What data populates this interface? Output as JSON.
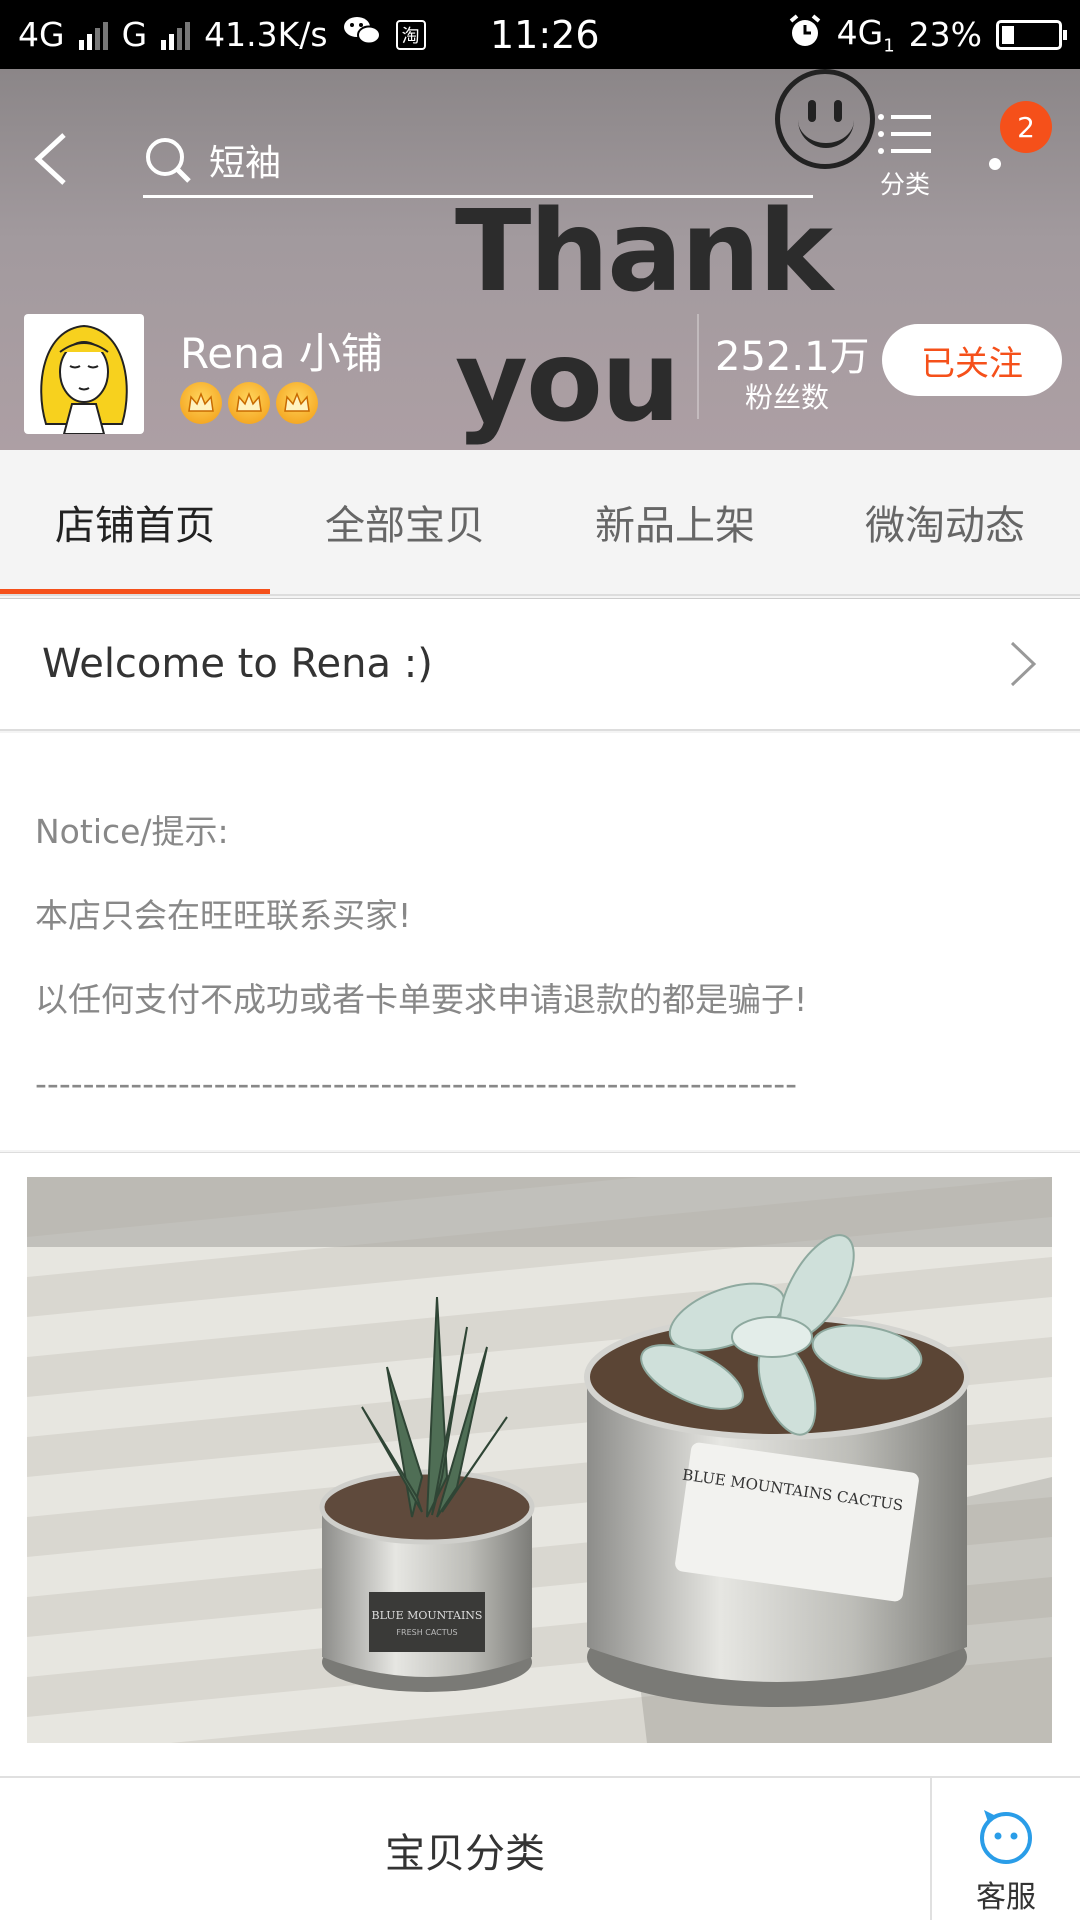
{
  "status_bar": {
    "network1": "4G",
    "network2": "G",
    "speed": "41.3K/s",
    "app_icon_char": "淘",
    "time": "11:26",
    "network3": "4G",
    "network3_sub": "1",
    "battery": "23%",
    "battery_level": 0.23
  },
  "header": {
    "banner_text": "Thank you",
    "search_query": "短袖",
    "category_label": "分类",
    "message_count": "2"
  },
  "shop": {
    "name": "Rena 小铺",
    "crown_count": 3,
    "fans_count": "252.1万",
    "fans_label": "粉丝数",
    "follow_label": "已关注"
  },
  "tabs": [
    {
      "label": "店铺首页",
      "active": true
    },
    {
      "label": "全部宝贝",
      "active": false
    },
    {
      "label": "新品上架",
      "active": false
    },
    {
      "label": "微淘动态",
      "active": false
    }
  ],
  "welcome": {
    "text": "Welcome to Rena :)"
  },
  "notice": {
    "title": "Notice/提示:",
    "line1": "本店只会在旺旺联系买家!",
    "line2": "以任何支付不成功或者卡单要求申请退款的都是骗子!",
    "separator": "----------------------------------------------------------------"
  },
  "photo": {
    "label_large": "BLUE MOUNTAINS CACTUS",
    "label_small": "BLUE MOUNTAINS",
    "label_small_sub": "FRESH CACTUS"
  },
  "bottom_bar": {
    "category_label": "宝贝分类",
    "service_label": "客服"
  },
  "colors": {
    "accent": "#f5501a",
    "status_bar": "#000000"
  }
}
